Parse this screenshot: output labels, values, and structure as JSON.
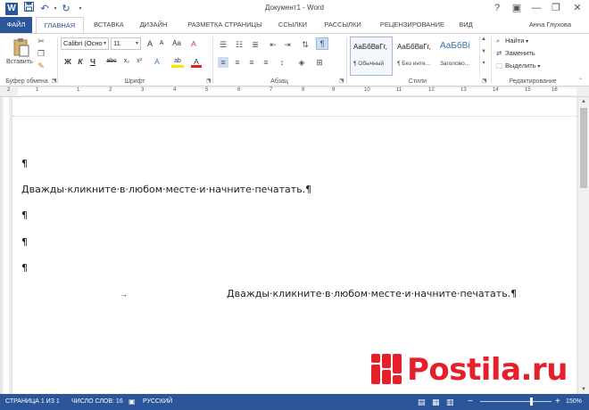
{
  "titlebar": {
    "app_icon": "W",
    "title": "Документ1 - Word",
    "quick_access": {
      "save": "save-icon",
      "undo": "undo-icon",
      "redo": "redo-icon",
      "customize": "chevron-down-icon"
    },
    "window_controls": {
      "help": "?",
      "ribbon_display": "▣",
      "minimize": "—",
      "restore": "❐",
      "close": "✕"
    }
  },
  "tabs": [
    {
      "label": "ФАЙЛ"
    },
    {
      "label": "ГЛАВНАЯ"
    },
    {
      "label": "ВСТАВКА"
    },
    {
      "label": "ДИЗАЙН"
    },
    {
      "label": "РАЗМЕТКА СТРАНИЦЫ"
    },
    {
      "label": "ССЫЛКИ"
    },
    {
      "label": "РАССЫЛКИ"
    },
    {
      "label": "РЕЦЕНЗИРОВАНИЕ"
    },
    {
      "label": "ВИД"
    }
  ],
  "user_name": "Анна Глухова",
  "ribbon": {
    "clipboard": {
      "paste_label": "Вставить",
      "group_label": "Буфер обмена"
    },
    "font": {
      "font_name": "Calibri (Осно",
      "font_size": "11",
      "grow": "A",
      "shrink": "A",
      "case": "Aa",
      "clear": "A",
      "bold": "Ж",
      "italic": "К",
      "underline": "Ч",
      "strike": "abc",
      "subscript": "x₂",
      "superscript": "x²",
      "effects": "A",
      "highlight": "ab",
      "color": "A",
      "group_label": "Шрифт"
    },
    "paragraph": {
      "pilcrow": "¶",
      "group_label": "Абзац"
    },
    "styles": {
      "items": [
        {
          "sample": "АаБбВвГг,",
          "name": "¶ Обычный"
        },
        {
          "sample": "АаБбВвГг,",
          "name": "¶ Без инте..."
        },
        {
          "sample": "АаБбВі",
          "name": "Заголово..."
        }
      ],
      "group_label": "Стили"
    },
    "editing": {
      "find": "Найти",
      "replace": "Заменить",
      "select": "Выделить",
      "group_label": "Редактирование"
    }
  },
  "ruler": {
    "numbers": [
      "2",
      "1",
      "1",
      "2",
      "3",
      "4",
      "5",
      "6",
      "7",
      "8",
      "9",
      "10",
      "11",
      "12",
      "13",
      "14",
      "15",
      "16"
    ]
  },
  "document": {
    "paragraphs": [
      "¶",
      "Дважды·кликните·в·любом·месте·и·начните·печатать.¶",
      "¶",
      "¶",
      "¶",
      "Дважды·кликните·в·любом·месте·и·начните·печатать.¶"
    ],
    "tab_mark": "→"
  },
  "statusbar": {
    "page": "СТРАНИЦА 1 ИЗ 1",
    "words": "ЧИСЛО СЛОВ: 16",
    "language": "РУССКИЙ",
    "zoom_minus": "−",
    "zoom_plus": "+",
    "zoom": "150%"
  },
  "watermark": {
    "text": "Postila.ru",
    "color": "#e4212b"
  },
  "colors": {
    "accent": "#2b579a",
    "status_bar": "#2b579a"
  }
}
